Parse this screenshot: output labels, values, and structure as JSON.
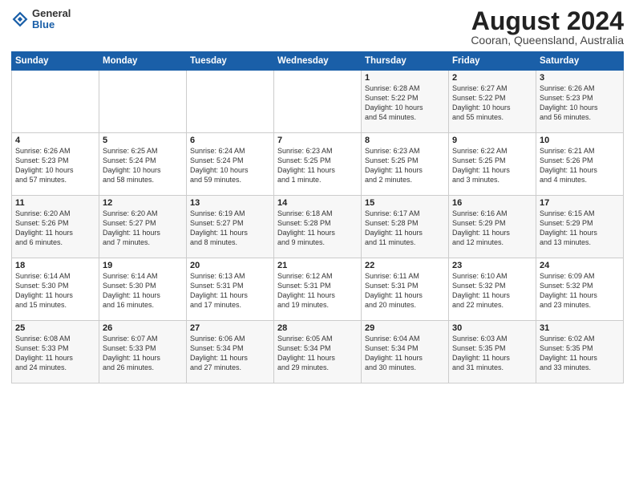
{
  "header": {
    "logo_line1": "General",
    "logo_line2": "Blue",
    "month_year": "August 2024",
    "location": "Cooran, Queensland, Australia"
  },
  "days_of_week": [
    "Sunday",
    "Monday",
    "Tuesday",
    "Wednesday",
    "Thursday",
    "Friday",
    "Saturday"
  ],
  "weeks": [
    [
      {
        "day": "",
        "content": ""
      },
      {
        "day": "",
        "content": ""
      },
      {
        "day": "",
        "content": ""
      },
      {
        "day": "",
        "content": ""
      },
      {
        "day": "1",
        "content": "Sunrise: 6:28 AM\nSunset: 5:22 PM\nDaylight: 10 hours\nand 54 minutes."
      },
      {
        "day": "2",
        "content": "Sunrise: 6:27 AM\nSunset: 5:22 PM\nDaylight: 10 hours\nand 55 minutes."
      },
      {
        "day": "3",
        "content": "Sunrise: 6:26 AM\nSunset: 5:23 PM\nDaylight: 10 hours\nand 56 minutes."
      }
    ],
    [
      {
        "day": "4",
        "content": "Sunrise: 6:26 AM\nSunset: 5:23 PM\nDaylight: 10 hours\nand 57 minutes."
      },
      {
        "day": "5",
        "content": "Sunrise: 6:25 AM\nSunset: 5:24 PM\nDaylight: 10 hours\nand 58 minutes."
      },
      {
        "day": "6",
        "content": "Sunrise: 6:24 AM\nSunset: 5:24 PM\nDaylight: 10 hours\nand 59 minutes."
      },
      {
        "day": "7",
        "content": "Sunrise: 6:23 AM\nSunset: 5:25 PM\nDaylight: 11 hours\nand 1 minute."
      },
      {
        "day": "8",
        "content": "Sunrise: 6:23 AM\nSunset: 5:25 PM\nDaylight: 11 hours\nand 2 minutes."
      },
      {
        "day": "9",
        "content": "Sunrise: 6:22 AM\nSunset: 5:25 PM\nDaylight: 11 hours\nand 3 minutes."
      },
      {
        "day": "10",
        "content": "Sunrise: 6:21 AM\nSunset: 5:26 PM\nDaylight: 11 hours\nand 4 minutes."
      }
    ],
    [
      {
        "day": "11",
        "content": "Sunrise: 6:20 AM\nSunset: 5:26 PM\nDaylight: 11 hours\nand 6 minutes."
      },
      {
        "day": "12",
        "content": "Sunrise: 6:20 AM\nSunset: 5:27 PM\nDaylight: 11 hours\nand 7 minutes."
      },
      {
        "day": "13",
        "content": "Sunrise: 6:19 AM\nSunset: 5:27 PM\nDaylight: 11 hours\nand 8 minutes."
      },
      {
        "day": "14",
        "content": "Sunrise: 6:18 AM\nSunset: 5:28 PM\nDaylight: 11 hours\nand 9 minutes."
      },
      {
        "day": "15",
        "content": "Sunrise: 6:17 AM\nSunset: 5:28 PM\nDaylight: 11 hours\nand 11 minutes."
      },
      {
        "day": "16",
        "content": "Sunrise: 6:16 AM\nSunset: 5:29 PM\nDaylight: 11 hours\nand 12 minutes."
      },
      {
        "day": "17",
        "content": "Sunrise: 6:15 AM\nSunset: 5:29 PM\nDaylight: 11 hours\nand 13 minutes."
      }
    ],
    [
      {
        "day": "18",
        "content": "Sunrise: 6:14 AM\nSunset: 5:30 PM\nDaylight: 11 hours\nand 15 minutes."
      },
      {
        "day": "19",
        "content": "Sunrise: 6:14 AM\nSunset: 5:30 PM\nDaylight: 11 hours\nand 16 minutes."
      },
      {
        "day": "20",
        "content": "Sunrise: 6:13 AM\nSunset: 5:31 PM\nDaylight: 11 hours\nand 17 minutes."
      },
      {
        "day": "21",
        "content": "Sunrise: 6:12 AM\nSunset: 5:31 PM\nDaylight: 11 hours\nand 19 minutes."
      },
      {
        "day": "22",
        "content": "Sunrise: 6:11 AM\nSunset: 5:31 PM\nDaylight: 11 hours\nand 20 minutes."
      },
      {
        "day": "23",
        "content": "Sunrise: 6:10 AM\nSunset: 5:32 PM\nDaylight: 11 hours\nand 22 minutes."
      },
      {
        "day": "24",
        "content": "Sunrise: 6:09 AM\nSunset: 5:32 PM\nDaylight: 11 hours\nand 23 minutes."
      }
    ],
    [
      {
        "day": "25",
        "content": "Sunrise: 6:08 AM\nSunset: 5:33 PM\nDaylight: 11 hours\nand 24 minutes."
      },
      {
        "day": "26",
        "content": "Sunrise: 6:07 AM\nSunset: 5:33 PM\nDaylight: 11 hours\nand 26 minutes."
      },
      {
        "day": "27",
        "content": "Sunrise: 6:06 AM\nSunset: 5:34 PM\nDaylight: 11 hours\nand 27 minutes."
      },
      {
        "day": "28",
        "content": "Sunrise: 6:05 AM\nSunset: 5:34 PM\nDaylight: 11 hours\nand 29 minutes."
      },
      {
        "day": "29",
        "content": "Sunrise: 6:04 AM\nSunset: 5:34 PM\nDaylight: 11 hours\nand 30 minutes."
      },
      {
        "day": "30",
        "content": "Sunrise: 6:03 AM\nSunset: 5:35 PM\nDaylight: 11 hours\nand 31 minutes."
      },
      {
        "day": "31",
        "content": "Sunrise: 6:02 AM\nSunset: 5:35 PM\nDaylight: 11 hours\nand 33 minutes."
      }
    ]
  ]
}
